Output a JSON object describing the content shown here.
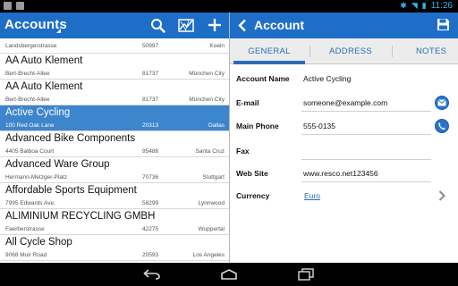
{
  "status_bar": {
    "time": "11:26"
  },
  "list_pane": {
    "title": "Accounts",
    "rows": [
      {
        "name": "",
        "street": "Landsbergerstrasse",
        "zip": "50997",
        "city": "Koeln",
        "partial": true
      },
      {
        "name": "AA Auto Klement",
        "street": "Bert-Brecht-Allee",
        "zip": "81737",
        "city": "München City"
      },
      {
        "name": "AA Auto Klement",
        "street": "Bert-Brecht-Allee",
        "zip": "81737",
        "city": "München City"
      },
      {
        "name": "Active Cycling",
        "street": "100 Red Oak Lane",
        "zip": "20313",
        "city": "Dallas",
        "selected": true
      },
      {
        "name": "Advanced Bike Components",
        "street": "4405 Balboa Court",
        "zip": "95486",
        "city": "Santa Cruz"
      },
      {
        "name": "Advanced Ware Group",
        "street": "Hermann-Metzger-Platz",
        "zip": "70736",
        "city": "Stuttgart"
      },
      {
        "name": "Affordable Sports Equipment",
        "street": "7995 Edwards Ave.",
        "zip": "58299",
        "city": "Lynnwood"
      },
      {
        "name": "ALIMINIUM RECYCLING GMBH",
        "street": "Faerberstrasse",
        "zip": "42275",
        "city": "Wuppertal"
      },
      {
        "name": "All Cycle Shop",
        "street": "9068 Muir Road",
        "zip": "20593",
        "city": "Los Angeles"
      }
    ]
  },
  "detail_pane": {
    "title": "Account",
    "tabs": [
      {
        "label": "GENERAL",
        "active": true
      },
      {
        "label": "ADDRESS",
        "active": false
      },
      {
        "label": "NOTES",
        "active": false
      }
    ],
    "fields": {
      "account_name": {
        "label": "Account Name",
        "value": "Active Cycling"
      },
      "email": {
        "label": "E-mail",
        "value": "someone@example.com"
      },
      "main_phone": {
        "label": "Main Phone",
        "value": "555-0135"
      },
      "fax": {
        "label": "Fax",
        "value": ""
      },
      "web_site": {
        "label": "Web Site",
        "value": "www.resco.net123456"
      },
      "currency": {
        "label": "Currency",
        "value": "Euro"
      }
    }
  },
  "colors": {
    "action_bar": "#1e6ec8",
    "selected_row": "#3d85cc",
    "accent": "#2a6cb8",
    "status_accent": "#33b5e5"
  },
  "icons": {
    "toolbar": [
      "search-icon",
      "map-icon",
      "add-icon"
    ],
    "detail": [
      "back-chevron-icon",
      "save-icon",
      "email-icon",
      "phone-icon",
      "chevron-right-icon"
    ],
    "nav": [
      "back-nav-icon",
      "home-nav-icon",
      "recents-nav-icon"
    ]
  }
}
